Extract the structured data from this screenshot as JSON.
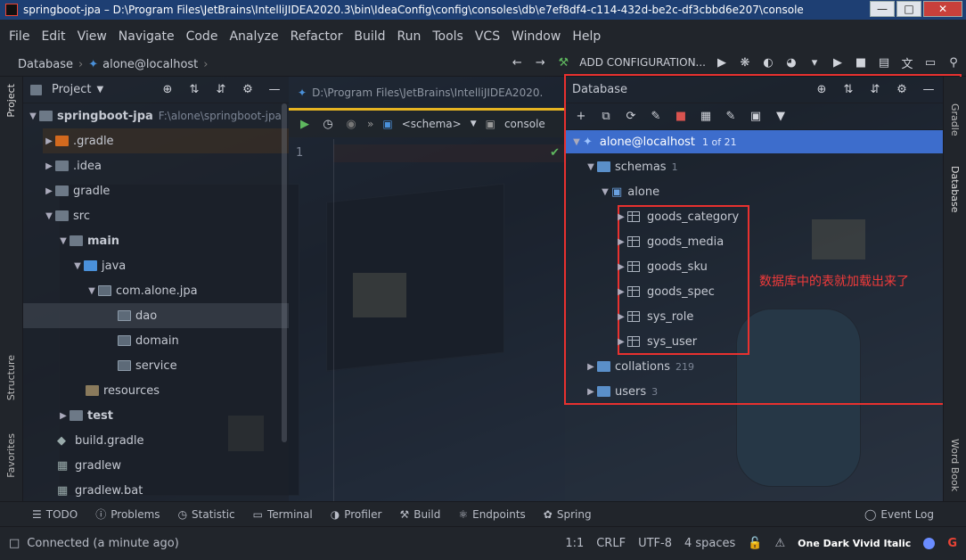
{
  "window": {
    "title": "springboot-jpa – D:\\Program Files\\JetBrains\\IntelliJIDEA2020.3\\bin\\IdeaConfig\\config\\consoles\\db\\e7ef8df4-c114-432d-be2c-df3cbbd6e207\\console"
  },
  "menu": [
    "File",
    "Edit",
    "View",
    "Navigate",
    "Code",
    "Analyze",
    "Refactor",
    "Build",
    "Run",
    "Tools",
    "VCS",
    "Window",
    "Help"
  ],
  "nav": {
    "crumb1": "Database",
    "crumb2": "alone@localhost",
    "add_config": "ADD CONFIGURATION..."
  },
  "project": {
    "title": "Project",
    "root": "springboot-jpa",
    "root_path": "F:\\alone\\springboot-jpa",
    "items": [
      ".gradle",
      ".idea",
      "gradle",
      "src",
      "main",
      "java",
      "com.alone.jpa",
      "dao",
      "domain",
      "service",
      "resources",
      "test",
      "build.gradle",
      "gradlew",
      "gradlew.bat"
    ]
  },
  "editor": {
    "tab": "D:\\Program Files\\JetBrains\\IntelliJIDEA2020.",
    "schema": "<schema>",
    "console": "console",
    "line1": "1"
  },
  "database": {
    "title": "Database",
    "conn": "alone@localhost",
    "conn_count": "1 of 21",
    "schemas": "schemas",
    "schemas_count": "1",
    "schema_name": "alone",
    "tables": [
      "goods_category",
      "goods_media",
      "goods_sku",
      "goods_spec",
      "sys_role",
      "sys_user"
    ],
    "collations": "collations",
    "collations_count": "219",
    "users": "users",
    "users_count": "3",
    "annotation": "数据库中的表就加载出来了"
  },
  "side_tabs": {
    "project": "Project",
    "structure": "Structure",
    "favorites": "Favorites",
    "gradle": "Gradle",
    "database": "Database",
    "wordbook": "Word Book"
  },
  "bottom_tools": [
    "TODO",
    "Problems",
    "Statistic",
    "Terminal",
    "Profiler",
    "Build",
    "Endpoints",
    "Spring"
  ],
  "event_log": "Event Log",
  "status": {
    "message": "Connected (a minute ago)",
    "pos": "1:1",
    "eol": "CRLF",
    "enc": "UTF-8",
    "indent": "4 spaces",
    "theme": "One Dark Vivid Italic"
  },
  "colors": {
    "selection": "#3d6dcc",
    "annotation": "#f03a3a",
    "accent_tab": "#e6b422"
  }
}
